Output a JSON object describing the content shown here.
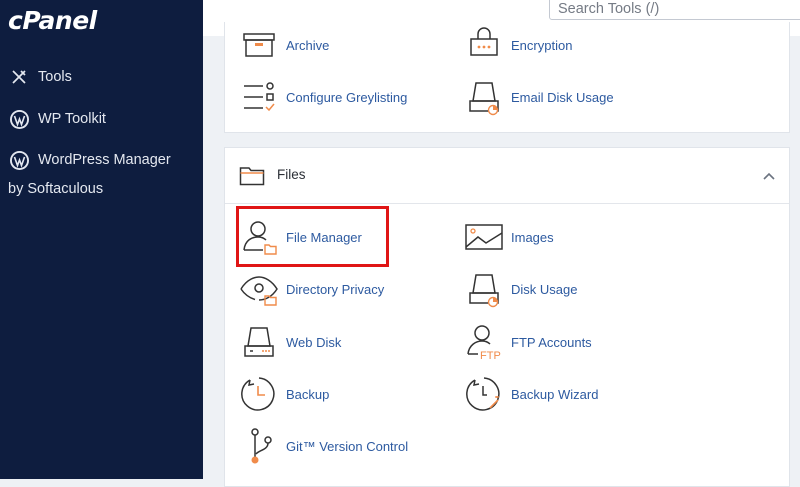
{
  "sidebar": {
    "logo": "cPanel",
    "items": [
      {
        "label": "Tools",
        "icon": "tools-icon"
      },
      {
        "label": "WP Toolkit",
        "icon": "wordpress-icon"
      },
      {
        "label": "WordPress Manager",
        "icon": "wordpress-icon"
      }
    ],
    "item3_sub": "by Softaculous"
  },
  "search": {
    "placeholder": "Search Tools (/)"
  },
  "top_section": {
    "tools": [
      {
        "label": "Archive",
        "icon": "archive-icon"
      },
      {
        "label": "Encryption",
        "icon": "encryption-icon"
      },
      {
        "label": "Configure Greylisting",
        "icon": "checklist-icon"
      },
      {
        "label": "Email Disk Usage",
        "icon": "disk-usage-icon"
      }
    ]
  },
  "files_section": {
    "title": "Files",
    "tools": [
      {
        "label": "File Manager",
        "icon": "user-folder-icon"
      },
      {
        "label": "Images",
        "icon": "image-icon"
      },
      {
        "label": "Directory Privacy",
        "icon": "eye-folder-icon"
      },
      {
        "label": "Disk Usage",
        "icon": "disk-usage-icon"
      },
      {
        "label": "Web Disk",
        "icon": "drive-icon"
      },
      {
        "label": "FTP Accounts",
        "icon": "ftp-user-icon"
      },
      {
        "label": "Backup",
        "icon": "clock-icon"
      },
      {
        "label": "Backup Wizard",
        "icon": "clock-wand-icon"
      },
      {
        "label": "Git™ Version Control",
        "icon": "git-icon"
      }
    ],
    "ftp_badge": "FTP"
  },
  "colors": {
    "sidebar": "#0e1d3f",
    "link": "#2d5aa0",
    "accent": "#f08b4a",
    "highlight": "#e01515"
  }
}
